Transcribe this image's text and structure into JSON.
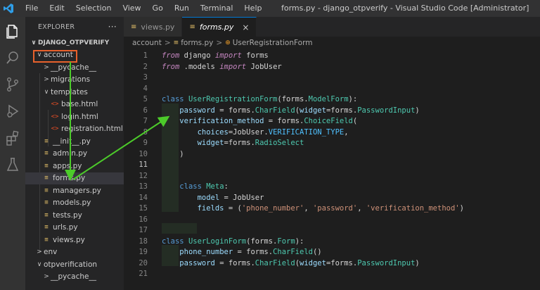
{
  "window": {
    "title": "forms.py - django_otpverify - Visual Studio Code [Administrator]",
    "menu": [
      "File",
      "Edit",
      "Selection",
      "View",
      "Go",
      "Run",
      "Terminal",
      "Help"
    ]
  },
  "activity_bar": [
    "explorer-icon",
    "search-icon",
    "source-control-icon",
    "run-debug-icon",
    "extensions-icon",
    "testing-icon"
  ],
  "explorer": {
    "title": "EXPLORER",
    "more": "···",
    "items": [
      {
        "label": "DJANGO_OTPVERIFY",
        "kind": "root",
        "chevron": "∨"
      },
      {
        "label": "account",
        "kind": "folder",
        "chevron": "∨",
        "highlighted": true
      },
      {
        "label": "__pycache__",
        "kind": "folder",
        "chevron": ">"
      },
      {
        "label": "migrations",
        "kind": "folder",
        "chevron": ">"
      },
      {
        "label": "templates",
        "kind": "folder",
        "chevron": "∨"
      },
      {
        "label": "base.html",
        "kind": "html",
        "icon": "<>"
      },
      {
        "label": "login.html",
        "kind": "html",
        "icon": "<>"
      },
      {
        "label": "registration.html",
        "kind": "html",
        "icon": "<>"
      },
      {
        "label": "__init__.py",
        "kind": "py",
        "icon": "≡"
      },
      {
        "label": "admin.py",
        "kind": "py",
        "icon": "≡"
      },
      {
        "label": "apps.py",
        "kind": "py",
        "icon": "≡"
      },
      {
        "label": "forms.py",
        "kind": "py",
        "icon": "≡",
        "selected": true
      },
      {
        "label": "managers.py",
        "kind": "py",
        "icon": "≡"
      },
      {
        "label": "models.py",
        "kind": "py",
        "icon": "≡"
      },
      {
        "label": "tests.py",
        "kind": "py",
        "icon": "≡"
      },
      {
        "label": "urls.py",
        "kind": "py",
        "icon": "≡"
      },
      {
        "label": "views.py",
        "kind": "py",
        "icon": "≡"
      },
      {
        "label": "env",
        "kind": "folder",
        "chevron": ">"
      },
      {
        "label": "otpverification",
        "kind": "folder",
        "chevron": "∨"
      },
      {
        "label": "__pycache__",
        "kind": "folder",
        "chevron": ">"
      }
    ]
  },
  "tabs": [
    {
      "label": "views.py",
      "active": false
    },
    {
      "label": "forms.py",
      "active": true,
      "close": "×"
    }
  ],
  "breadcrumb": {
    "folder": "account",
    "file": "forms.py",
    "symbol": "UserRegistrationForm",
    "separator": ">"
  },
  "editor": {
    "current_line": 11,
    "lines": [
      {
        "n": 1,
        "tokens": [
          [
            "k",
            "from"
          ],
          [
            "t",
            " django "
          ],
          [
            "k",
            "import"
          ],
          [
            "t",
            " forms"
          ]
        ]
      },
      {
        "n": 2,
        "tokens": [
          [
            "k",
            "from"
          ],
          [
            "t",
            " .models "
          ],
          [
            "k",
            "import"
          ],
          [
            "t",
            " JobUser"
          ]
        ]
      },
      {
        "n": 3,
        "tokens": []
      },
      {
        "n": 4,
        "tokens": []
      },
      {
        "n": 5,
        "tokens": [
          [
            "kb",
            "class"
          ],
          [
            "t",
            " "
          ],
          [
            "c",
            "UserRegistrationForm"
          ],
          [
            "t",
            "(forms."
          ],
          [
            "c",
            "ModelForm"
          ],
          [
            "t",
            "):"
          ]
        ]
      },
      {
        "n": 6,
        "tokens": [
          [
            "t",
            "    "
          ],
          [
            "v",
            "password"
          ],
          [
            "t",
            " = forms."
          ],
          [
            "c",
            "CharField"
          ],
          [
            "t",
            "("
          ],
          [
            "v",
            "widget"
          ],
          [
            "t",
            "=forms."
          ],
          [
            "c",
            "PasswordInput"
          ],
          [
            "t",
            ")"
          ]
        ]
      },
      {
        "n": 7,
        "tokens": [
          [
            "t",
            "    "
          ],
          [
            "v",
            "verification_method"
          ],
          [
            "t",
            " = forms."
          ],
          [
            "c",
            "ChoiceField"
          ],
          [
            "t",
            "("
          ]
        ]
      },
      {
        "n": 8,
        "tokens": [
          [
            "t",
            "        "
          ],
          [
            "v",
            "choices"
          ],
          [
            "t",
            "=JobUser."
          ],
          [
            "cc",
            "VERIFICATION_TYPE"
          ],
          [
            "t",
            ","
          ]
        ]
      },
      {
        "n": 9,
        "tokens": [
          [
            "t",
            "        "
          ],
          [
            "v",
            "widget"
          ],
          [
            "t",
            "=forms."
          ],
          [
            "c",
            "RadioSelect"
          ]
        ]
      },
      {
        "n": 10,
        "tokens": [
          [
            "t",
            "    )"
          ]
        ]
      },
      {
        "n": 11,
        "tokens": []
      },
      {
        "n": 12,
        "tokens": []
      },
      {
        "n": 13,
        "tokens": [
          [
            "t",
            "    "
          ],
          [
            "kb",
            "class"
          ],
          [
            "t",
            " "
          ],
          [
            "c",
            "Meta"
          ],
          [
            "t",
            ":"
          ]
        ]
      },
      {
        "n": 14,
        "tokens": [
          [
            "t",
            "        "
          ],
          [
            "v",
            "model"
          ],
          [
            "t",
            " = JobUser"
          ]
        ]
      },
      {
        "n": 15,
        "tokens": [
          [
            "t",
            "        "
          ],
          [
            "v",
            "fields"
          ],
          [
            "t",
            " = ("
          ],
          [
            "s",
            "'phone_number'"
          ],
          [
            "t",
            ", "
          ],
          [
            "s",
            "'password'"
          ],
          [
            "t",
            ", "
          ],
          [
            "s",
            "'verification_method'"
          ],
          [
            "t",
            ")"
          ]
        ]
      },
      {
        "n": 16,
        "tokens": []
      },
      {
        "n": 17,
        "tokens": []
      },
      {
        "n": 18,
        "tokens": [
          [
            "kb",
            "class"
          ],
          [
            "t",
            " "
          ],
          [
            "c",
            "UserLoginForm"
          ],
          [
            "t",
            "(forms."
          ],
          [
            "c",
            "Form"
          ],
          [
            "t",
            "):"
          ]
        ]
      },
      {
        "n": 19,
        "tokens": [
          [
            "t",
            "    "
          ],
          [
            "v",
            "phone_number"
          ],
          [
            "t",
            " = forms."
          ],
          [
            "c",
            "CharField"
          ],
          [
            "t",
            "()"
          ]
        ]
      },
      {
        "n": 20,
        "tokens": [
          [
            "t",
            "    "
          ],
          [
            "v",
            "password"
          ],
          [
            "t",
            " = forms."
          ],
          [
            "c",
            "CharField"
          ],
          [
            "t",
            "("
          ],
          [
            "v",
            "widget"
          ],
          [
            "t",
            "=forms."
          ],
          [
            "c",
            "PasswordInput"
          ],
          [
            "t",
            ")"
          ]
        ]
      },
      {
        "n": 21,
        "tokens": []
      }
    ]
  },
  "colors": {
    "annotation_box": "#e8612c",
    "annotation_arrow": "#4ccb2a"
  }
}
